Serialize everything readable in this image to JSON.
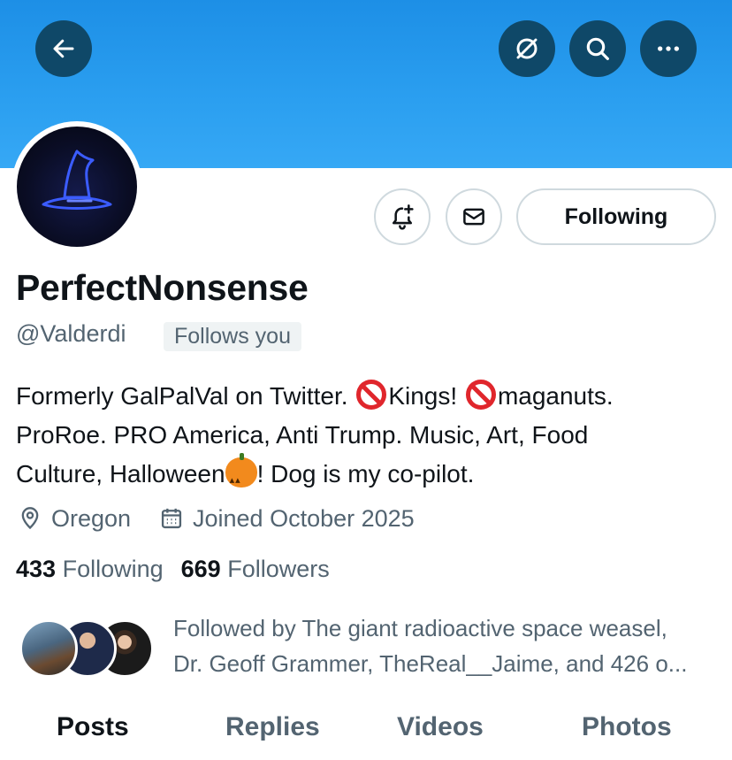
{
  "header": {
    "back_icon": "arrow-left-icon",
    "grok_icon": "slash-circle-icon",
    "search_icon": "search-icon",
    "more_icon": "more-dots-icon",
    "banner_color": "#2b9ff0"
  },
  "actions": {
    "notify_icon": "bell-plus-icon",
    "message_icon": "envelope-icon",
    "following_label": "Following"
  },
  "profile": {
    "name": "PerfectNonsense",
    "handle": "@Valderdi",
    "follows_you": "Follows you",
    "bio_line1_a": "Formerly GalPalVal on Twitter. ",
    "bio_line1_b": "Kings! ",
    "bio_line1_c": "maganuts.",
    "bio_line2": "ProRoe. PRO America, Anti Trump. Music, Art, Food",
    "bio_line3_a": "Culture, Halloween",
    "bio_line3_b": "! Dog is my co-pilot.",
    "location": "Oregon",
    "joined": "Joined October 2025"
  },
  "stats": {
    "following_count": "433",
    "following_label": "Following",
    "followers_count": "669",
    "followers_label": "Followers"
  },
  "followed_by": {
    "line1": "Followed by The giant radioactive space weasel,",
    "line2": "Dr. Geoff Grammer, TheReal__Jaime, and 426 o..."
  },
  "tabs": [
    "Posts",
    "Replies",
    "Videos",
    "Photos"
  ]
}
